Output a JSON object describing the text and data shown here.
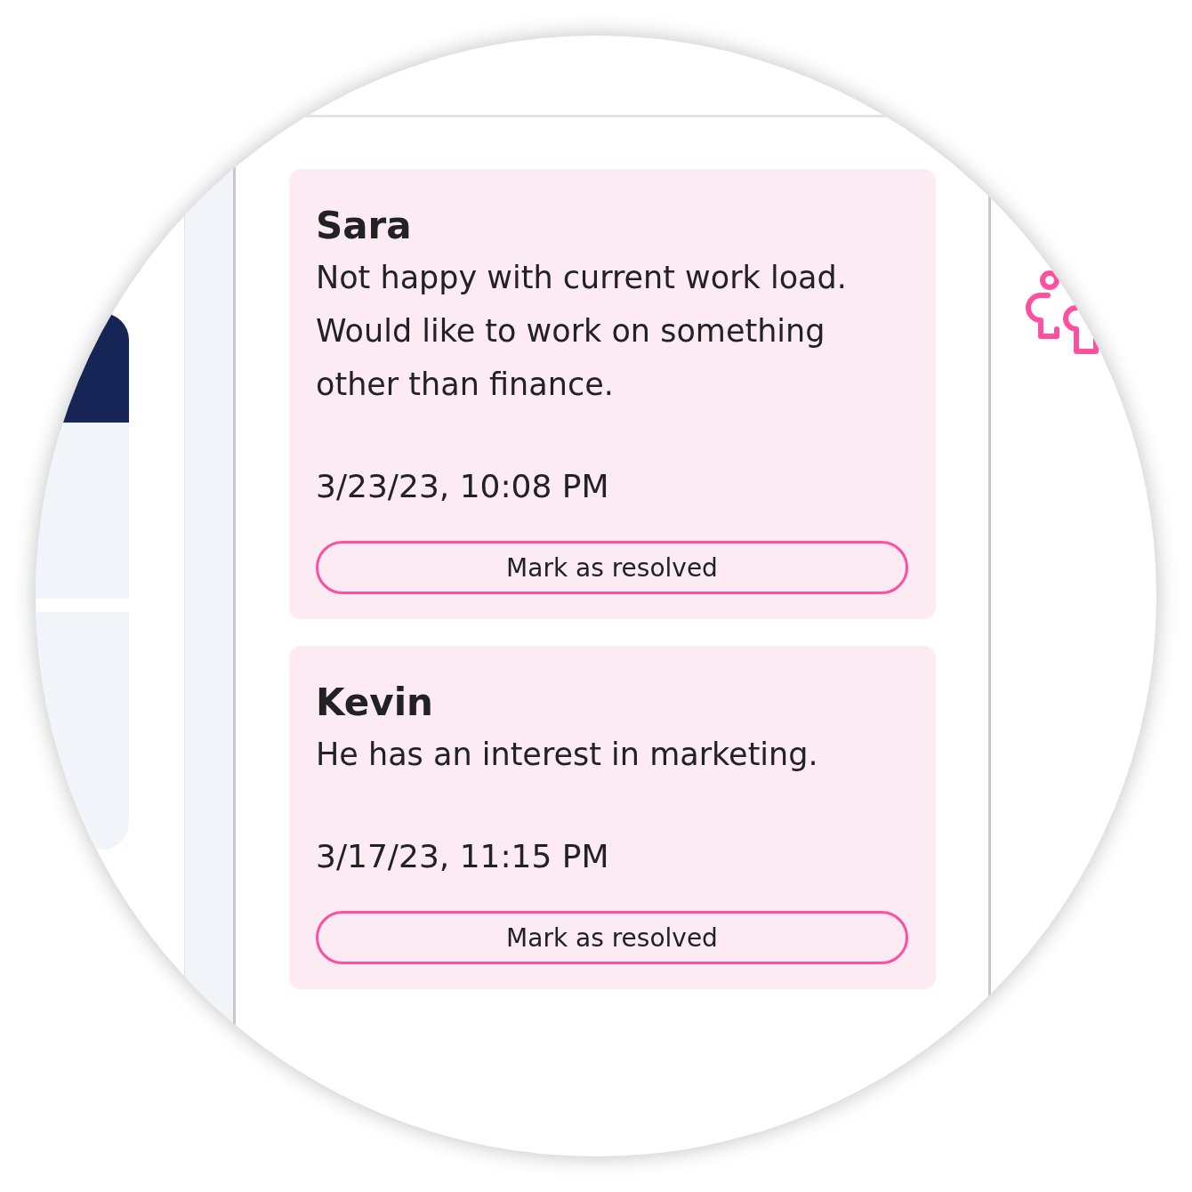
{
  "notes": [
    {
      "name": "Sara",
      "text": "Not happy with current work load. Would like to work on something other than finance.",
      "timestamp": "3/23/23, 10:08 PM",
      "button": "Mark as resolved"
    },
    {
      "name": "Kevin",
      "text": "He has an interest in marketing.",
      "timestamp": "3/17/23, 11:15 PM",
      "button": "Mark as resolved"
    }
  ]
}
